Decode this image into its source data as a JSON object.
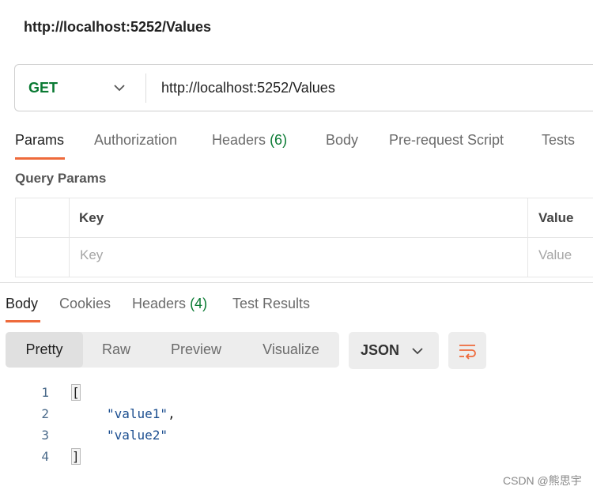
{
  "request": {
    "title": "http://localhost:5252/Values",
    "method": "GET",
    "url": "http://localhost:5252/Values"
  },
  "request_tabs": [
    {
      "label": "Params",
      "active": true
    },
    {
      "label": "Authorization"
    },
    {
      "label": "Headers",
      "count": "(6)"
    },
    {
      "label": "Body"
    },
    {
      "label": "Pre-request Script"
    },
    {
      "label": "Tests"
    }
  ],
  "query_params": {
    "title": "Query Params",
    "columns": {
      "key": "Key",
      "value": "Value"
    },
    "placeholders": {
      "key": "Key",
      "value": "Value"
    }
  },
  "response_tabs": [
    {
      "label": "Body",
      "active": true
    },
    {
      "label": "Cookies"
    },
    {
      "label": "Headers",
      "count": "(4)"
    },
    {
      "label": "Test Results"
    }
  ],
  "view_modes": [
    "Pretty",
    "Raw",
    "Preview",
    "Visualize"
  ],
  "active_view_mode": "Pretty",
  "format": "JSON",
  "code": {
    "line_numbers": [
      "1",
      "2",
      "3",
      "4"
    ],
    "open_bracket": "[",
    "values": [
      "\"value1\"",
      "\"value2\""
    ],
    "comma": ",",
    "close_bracket": "]"
  },
  "watermark": "CSDN @熊思宇",
  "colors": {
    "accent": "#ee6a3b",
    "method": "#0a7a33",
    "string": "#1a4d8f"
  }
}
